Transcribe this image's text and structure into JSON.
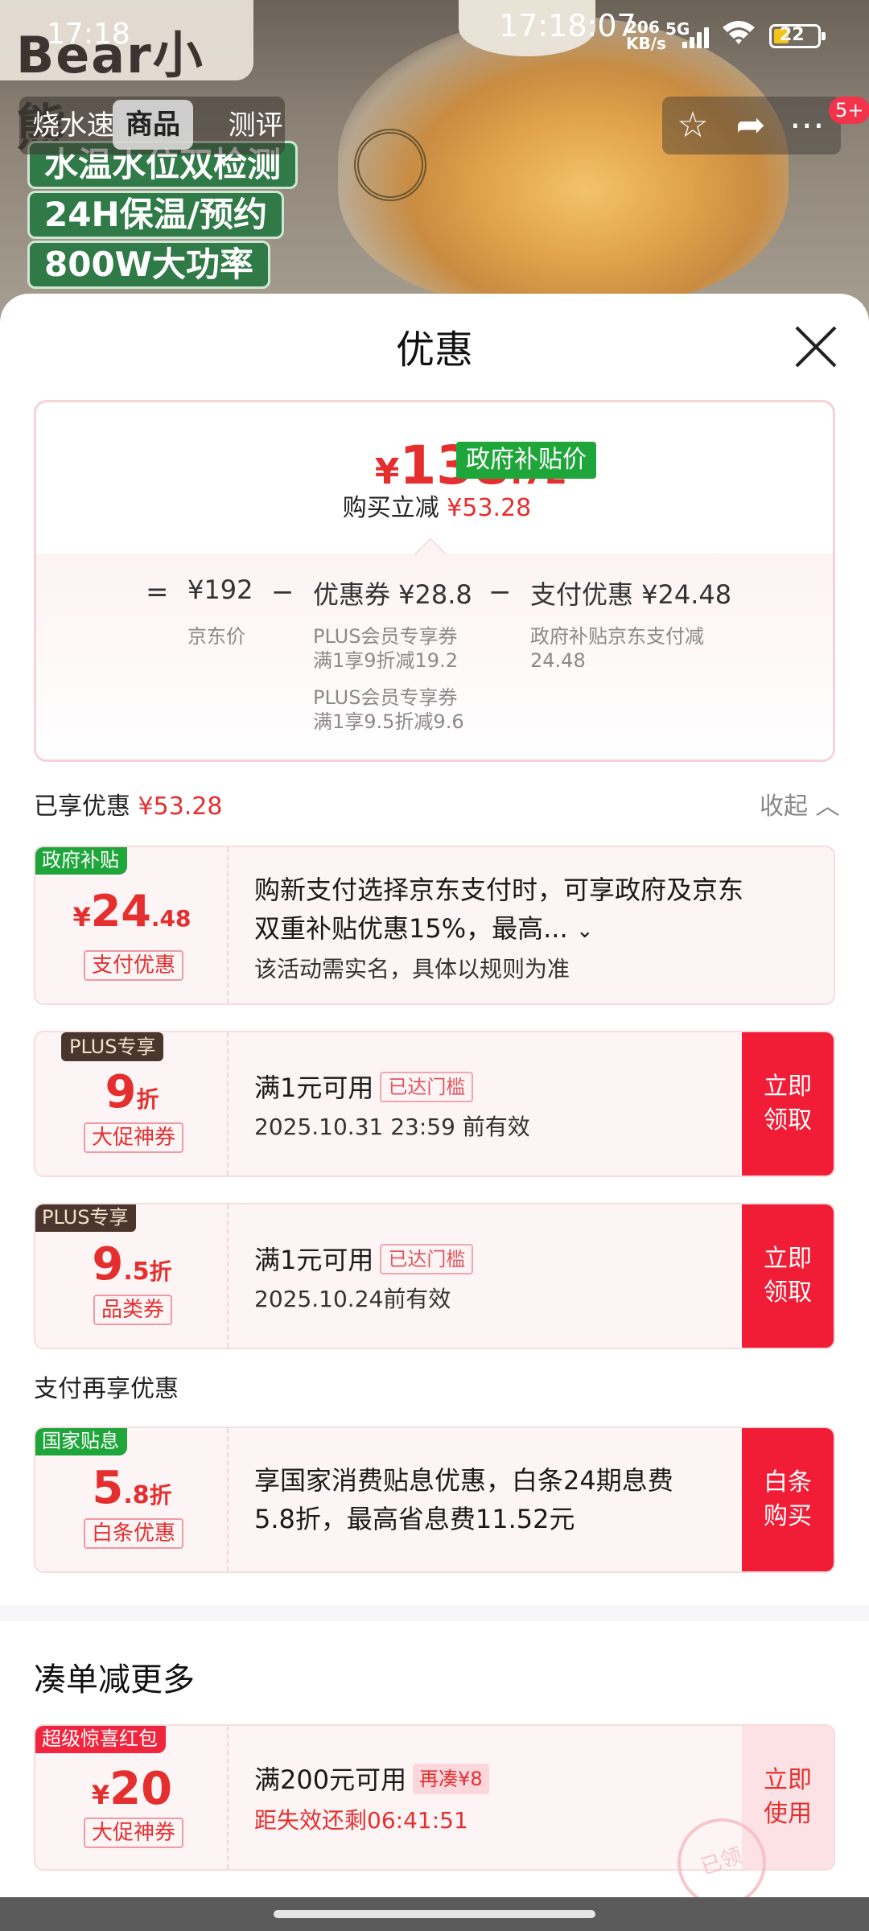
{
  "status": {
    "time": "17:18",
    "clock": "17:18:07",
    "net_speed_value": "206",
    "net_speed_unit": "KB/s",
    "network": "5G",
    "battery": "22"
  },
  "product": {
    "brand": "Bear小熊",
    "features": [
      "水温水位双检测",
      "24H保温/预约",
      "800W大功率"
    ]
  },
  "nav": {
    "left_text": "烧水速",
    "active_tab": "商品",
    "right_text": "测评",
    "badge": "5+",
    "icons": [
      "star-icon",
      "share-icon",
      "more-icon"
    ]
  },
  "sheet": {
    "title": "优惠"
  },
  "summary": {
    "price_currency": "¥",
    "price_int": "138",
    "price_dec": ".72",
    "gov_tag": "政府补贴价",
    "reduce_label": "购买立减",
    "reduce_amount": "¥53.28",
    "eq": "=",
    "minus": "−",
    "base_price": "¥192",
    "base_label": "京东价",
    "coupon_price": "优惠券 ¥28.8",
    "coupon_note1_line1": "PLUS会员专享券",
    "coupon_note1_line2": "满1享9折减19.2",
    "coupon_note2_line1": "PLUS会员专享券",
    "coupon_note2_line2": "满1享9.5折减9.6",
    "pay_price": "支付优惠 ¥24.48",
    "pay_note_line1": "政府补贴京东支付减",
    "pay_note_line2": "24.48"
  },
  "enjoyed": {
    "label": "已享优惠",
    "amount": "¥53.28",
    "collapse": "收起"
  },
  "coupons": [
    {
      "tag": "政府补贴",
      "value_main": "24",
      "value_prefix": "¥",
      "value_suffix": ".48",
      "type": "支付优惠",
      "desc_line1": "购新支付选择京东支付时，可享政府及京东",
      "desc_line2": "双重补贴优惠15%，最高...",
      "sub": "该活动需实名，具体以规则为准"
    },
    {
      "tag": "PLUS专享",
      "value_main": "9",
      "value_suffix": "折",
      "type": "大促神券",
      "desc": "满1元可用",
      "reached": "已达门槛",
      "sub": "2025.10.31 23:59 前有效",
      "button": "立即\n领取"
    },
    {
      "tag": "PLUS专享",
      "value_main": "9",
      "value_dec": ".5",
      "value_suffix": "折",
      "type": "品类券",
      "desc": "满1元可用",
      "reached": "已达门槛",
      "sub": "2025.10.24前有效",
      "button": "立即\n领取"
    },
    {
      "tag": "国家贴息",
      "value_main": "5",
      "value_dec": ".8",
      "value_suffix": "折",
      "type": "白条优惠",
      "desc_line1": "享国家消费贴息优惠，白条24期息费",
      "desc_line2": "5.8折，最高省息费11.52元",
      "button": "白条\n购买"
    }
  ],
  "pay_more": {
    "label": "支付再享优惠"
  },
  "more_section": {
    "title": "凑单减更多",
    "coupon": {
      "tag": "超级惊喜红包",
      "value_prefix": "¥",
      "value_main": "20",
      "type": "大促神券",
      "desc": "满200元可用",
      "add_more": "再凑¥8",
      "countdown": "距失效还剩06:41:51",
      "button": "立即\n使用",
      "stamp": "已领"
    }
  },
  "colors": {
    "accent_red": "#e52f2f",
    "button_red": "#f11c36",
    "gov_green": "#1fa63b"
  }
}
